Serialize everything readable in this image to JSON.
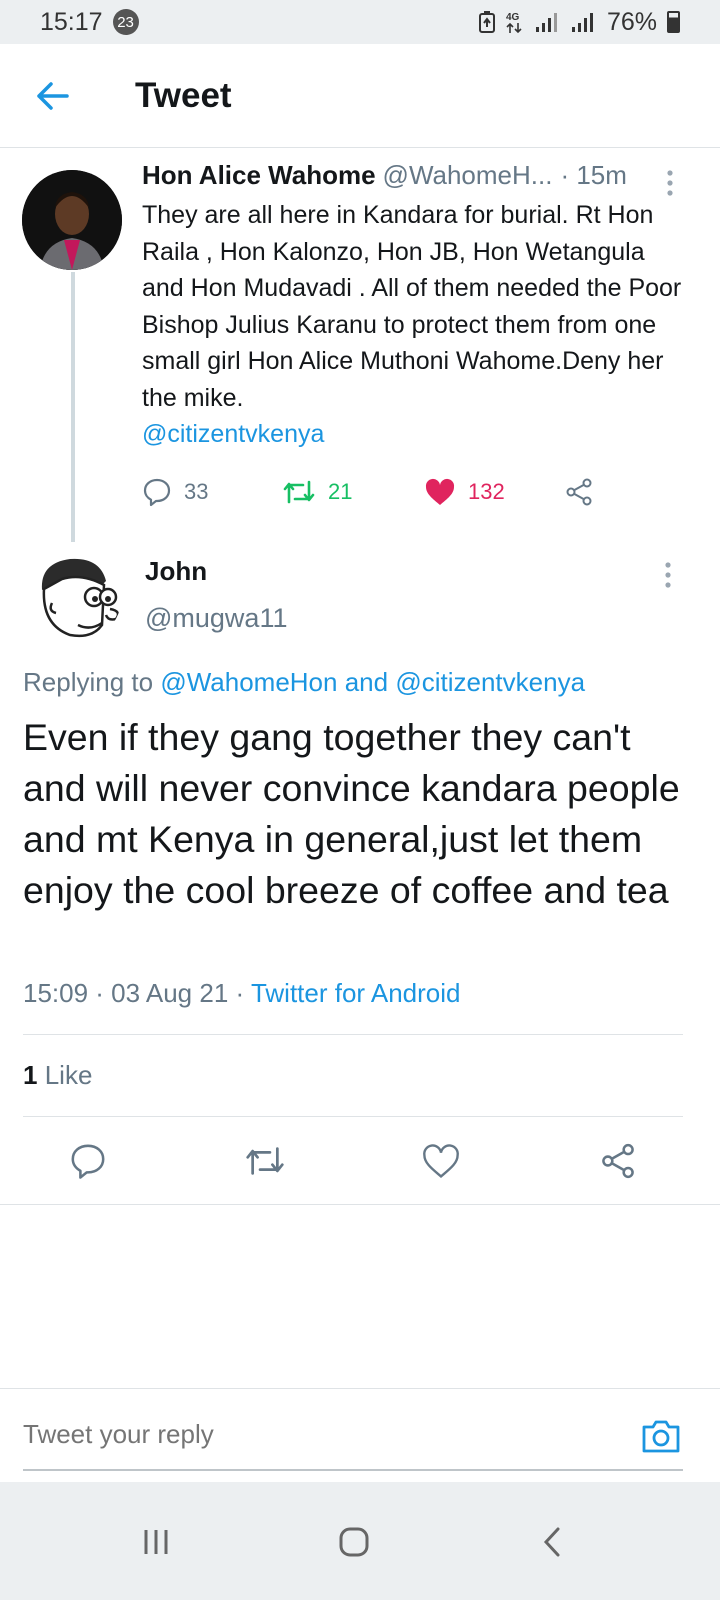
{
  "status_bar": {
    "time": "15:17",
    "notification_count": "23",
    "network": "4G",
    "battery": "76%"
  },
  "header": {
    "title": "Tweet"
  },
  "parent_tweet": {
    "name": "Hon Alice Wahome",
    "handle": "@WahomeH...",
    "time": "· 15m",
    "text": "They are all here in Kandara for burial. Rt Hon Raila , Hon Kalonzo, Hon JB, Hon Wetangula and Hon Mudavadi . All of them needed the Poor Bishop Julius Karanu to protect them from one small girl Hon Alice Muthoni Wahome.Deny her the mike.",
    "mention": "@citizentvkenya",
    "replies": "33",
    "retweets": "21",
    "likes": "132"
  },
  "reply_tweet": {
    "name": "John",
    "handle": "@mugwa11",
    "replying_prefix": "Replying to",
    "replying_user1": "@WahomeHon",
    "replying_and": "and",
    "replying_user2": "@citizentvkenya",
    "text": "Even if they gang together they can't and will never convince kandara people and mt Kenya in general,just let them enjoy the cool breeze of coffee and tea",
    "time": "15:09 · 03 Aug 21 ·",
    "source": "Twitter for Android",
    "like_count": "1",
    "like_label": "Like"
  },
  "composer": {
    "placeholder": "Tweet your reply"
  },
  "colors": {
    "accent": "#1b95e0",
    "retweet": "#17bf63",
    "like": "#e0245e",
    "secondary_text": "#657786"
  }
}
